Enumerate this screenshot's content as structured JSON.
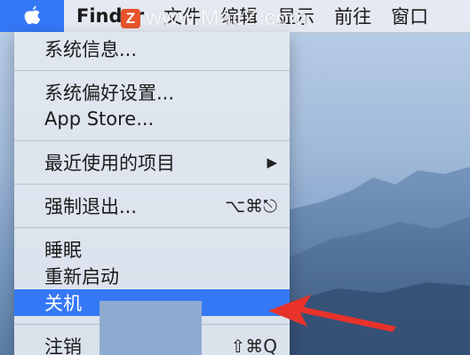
{
  "menubar": {
    "app_name": "Finder",
    "menus": [
      "文件",
      "编辑",
      "显示",
      "前往",
      "窗口"
    ]
  },
  "watermark": {
    "logo_letter": "Z",
    "text": "www.MacZ.com"
  },
  "apple_menu": {
    "items": [
      {
        "label": "系统信息..."
      },
      {
        "label": "系统偏好设置..."
      },
      {
        "label": "App Store..."
      },
      {
        "label": "最近使用的项目"
      },
      {
        "label": "强制退出...",
        "shortcut": "⌥⌘⎋"
      },
      {
        "label": "睡眠"
      },
      {
        "label": "重新启动"
      },
      {
        "label": "关机"
      },
      {
        "label": "注销",
        "shortcut": "⇧⌘Q"
      }
    ]
  },
  "colors": {
    "highlight": "#3478f6",
    "annotation_arrow": "#e8322a"
  }
}
